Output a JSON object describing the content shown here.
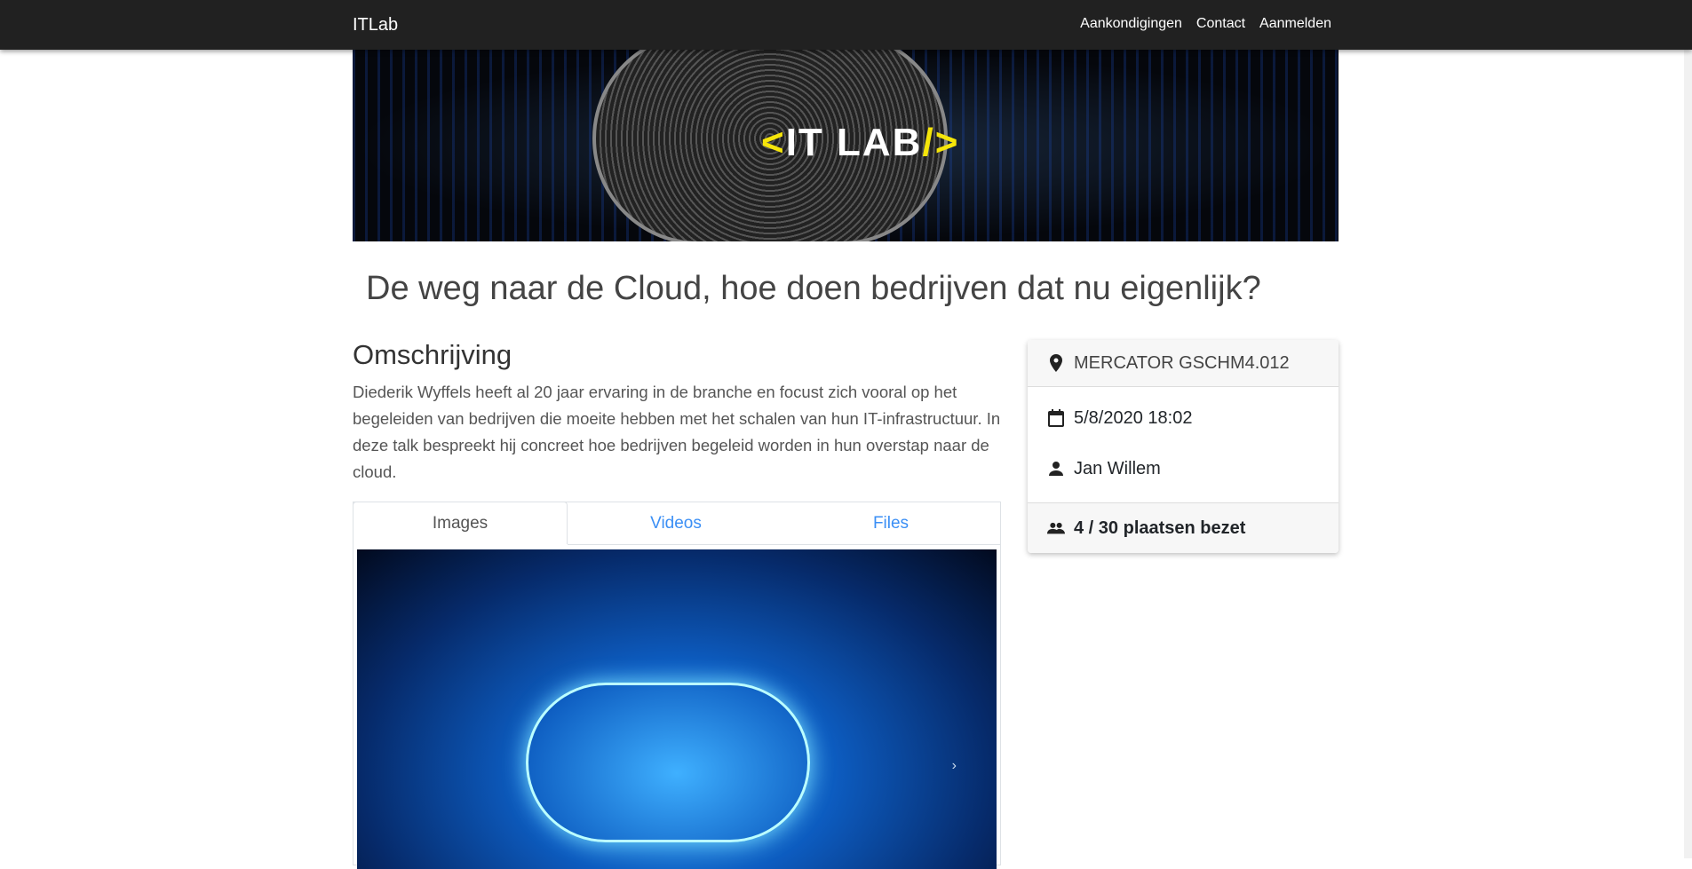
{
  "navbar": {
    "brand": "ITLab",
    "links": [
      "Aankondigingen",
      "Contact",
      "Aanmelden"
    ]
  },
  "banner": {
    "logo": "<IT LAB/>"
  },
  "page": {
    "title": "De weg naar de Cloud, hoe doen bedrijven dat nu eigenlijk?"
  },
  "description": {
    "heading": "Omschrijving",
    "text": "Diederik Wyffels heeft al 20 jaar ervaring in de branche en focust zich vooral op het begeleiden van bedrijven die moeite hebben met het schalen van hun IT-infrastructuur. In deze talk bespreekt hij concreet hoe bedrijven begeleid worden in hun overstap naar de cloud."
  },
  "tabs": [
    {
      "label": "Images",
      "active": true
    },
    {
      "label": "Videos"
    },
    {
      "label": "Files"
    }
  ],
  "card": {
    "location": "MERCATOR GSCHM4.012",
    "datetime": "5/8/2020 18:02",
    "speaker": "Jan Willem",
    "seats": "4 / 30 plaatsen bezet"
  },
  "colors": {
    "navbar": "#212121",
    "link": "#3b8ff5"
  }
}
